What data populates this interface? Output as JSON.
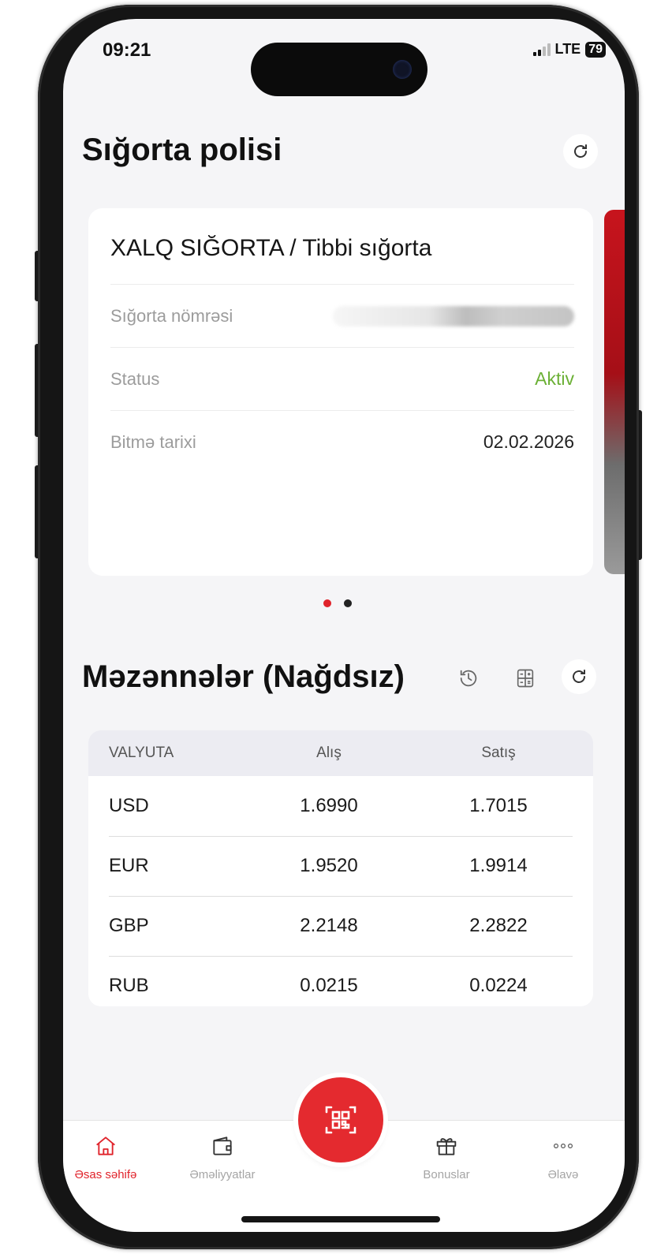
{
  "status_bar": {
    "time": "09:21",
    "network": "LTE",
    "battery": "79"
  },
  "insurance": {
    "title": "Sığorta polisi",
    "card": {
      "title": "XALQ SIĞORTA / Tibbi sığorta",
      "rows": [
        {
          "label": "Sığorta nömrəsi",
          "value": ""
        },
        {
          "label": "Status",
          "value": "Aktiv"
        },
        {
          "label": "Bitmə tarixi",
          "value": "02.02.2026"
        }
      ]
    },
    "pager": {
      "count": 2,
      "active_index": 0
    }
  },
  "rates": {
    "title": "Məzənnələr (Nağdsız)",
    "headers": {
      "currency": "VALYUTA",
      "buy": "Alış",
      "sell": "Satış"
    },
    "rows": [
      {
        "currency": "USD",
        "buy": "1.6990",
        "sell": "1.7015"
      },
      {
        "currency": "EUR",
        "buy": "1.9520",
        "sell": "1.9914"
      },
      {
        "currency": "GBP",
        "buy": "2.2148",
        "sell": "2.2822"
      },
      {
        "currency": "RUB",
        "buy": "0.0215",
        "sell": "0.0224"
      }
    ]
  },
  "tabbar": {
    "home": "Əsas səhifə",
    "operations": "Əməliyyatlar",
    "bonuses": "Bonuslar",
    "more": "Əlavə"
  },
  "icons": {
    "refresh": "refresh-icon",
    "history": "history-icon",
    "calculator": "calculator-icon",
    "home": "home-icon",
    "wallet": "wallet-icon",
    "qr": "qr-scan-icon",
    "gift": "gift-icon",
    "more": "more-dots-icon"
  },
  "colors": {
    "accent": "#e0232b",
    "active_status": "#6bb035",
    "text": "#111111",
    "muted": "#9c9c9c"
  }
}
